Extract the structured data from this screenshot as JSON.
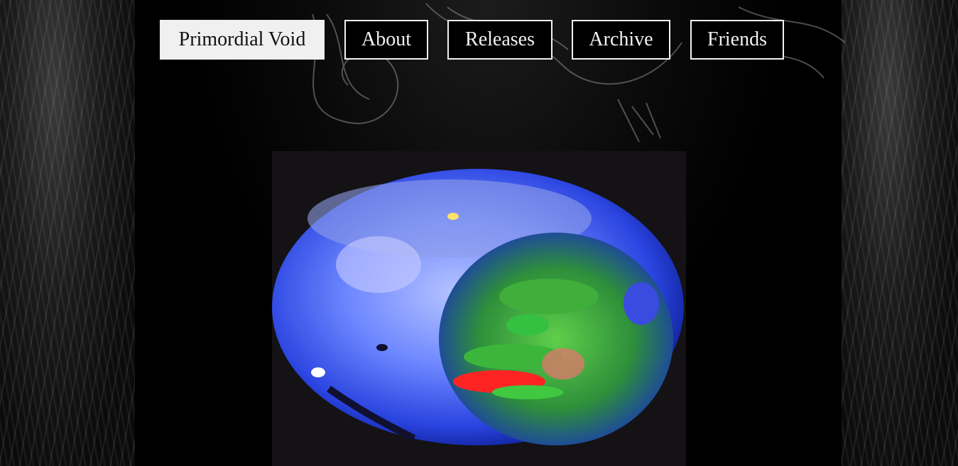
{
  "nav": {
    "items": [
      {
        "label": "Primordial Void",
        "active": true
      },
      {
        "label": "About",
        "active": false
      },
      {
        "label": "Releases",
        "active": false
      },
      {
        "label": "Archive",
        "active": false
      },
      {
        "label": "Friends",
        "active": false
      }
    ]
  },
  "media": {
    "icon": "glitch-orb-video"
  },
  "colors": {
    "background": "#000000",
    "nav_border": "#f2f2f2",
    "active_bg": "#f0f0f0",
    "orb_blue": "#5b79ff",
    "orb_green": "#2fbf3a",
    "orb_red": "#ff2a2a"
  }
}
